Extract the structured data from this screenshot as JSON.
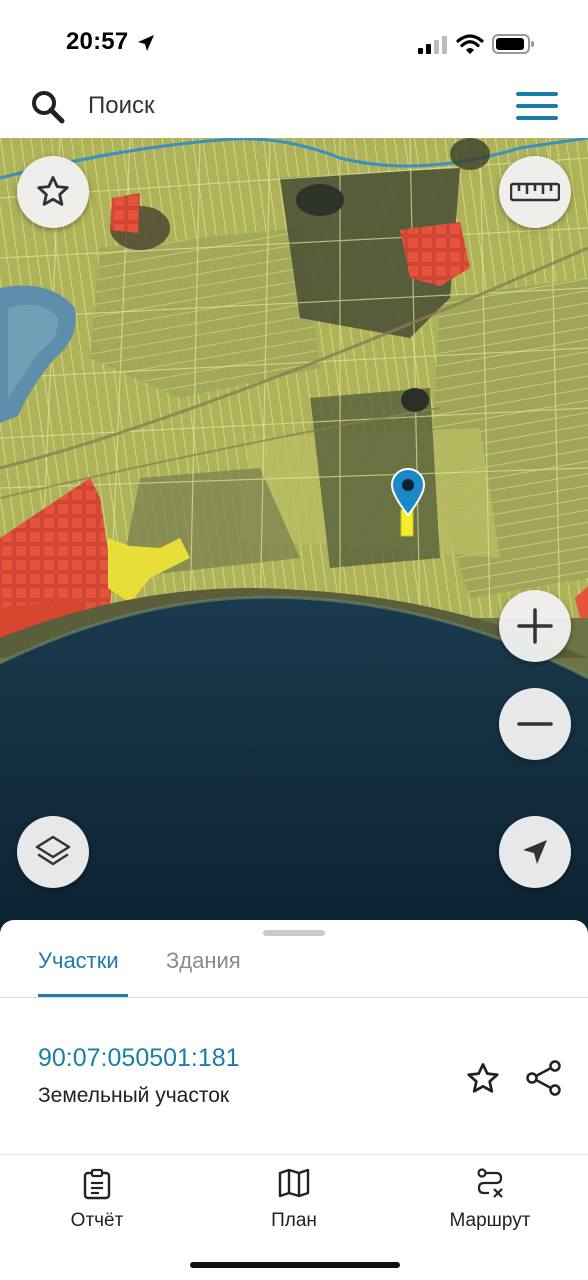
{
  "status_bar": {
    "time": "20:57"
  },
  "search": {
    "placeholder": "Поиск"
  },
  "tabs": [
    {
      "label": "Участки",
      "active": true
    },
    {
      "label": "Здания",
      "active": false
    }
  ],
  "parcel": {
    "cadastral_number": "90:07:050501:181",
    "type": "Земельный участок"
  },
  "bottom_nav": [
    {
      "label": "Отчёт",
      "icon": "report-icon"
    },
    {
      "label": "План",
      "icon": "map-icon"
    },
    {
      "label": "Маршрут",
      "icon": "route-icon"
    }
  ],
  "map_controls": [
    "star-icon",
    "ruler-icon",
    "zoom-in-icon",
    "zoom-out-icon",
    "layers-icon",
    "locate-icon"
  ],
  "colors": {
    "accent": "#1a7fa8",
    "sea": "#0f2a3d",
    "parcel_yellow": "#c9c860",
    "parcel_red": "#e5533d",
    "selected_parcel": "#f4ee2a"
  }
}
